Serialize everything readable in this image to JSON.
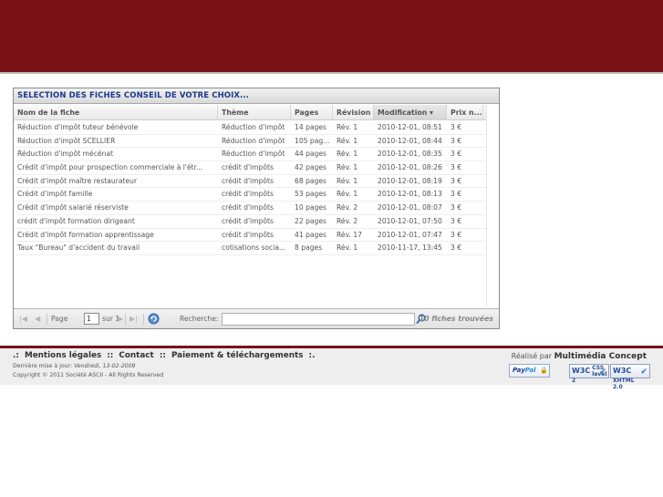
{
  "grid": {
    "title": "SELECTION DES FICHES CONSEIL DE VOTRE CHOIX...",
    "columns": [
      "Nom de la fiche",
      "Thème",
      "Pages",
      "Révision",
      "Modification ▾",
      "Prix n..."
    ],
    "rows": [
      [
        "Réduction d'impôt tuteur bénévole",
        "Réduction d'impôt",
        "14 pages",
        "Rév. 1",
        "2010-12-01, 08:51",
        "3 €"
      ],
      [
        "Réduction d'impôt SCELLIER",
        "Réduction d'impôt",
        "105 pag...",
        "Rév. 1",
        "2010-12-01, 08:44",
        "3 €"
      ],
      [
        "Réduction d'impôt mécénat",
        "Réduction d'impôt",
        "44 pages",
        "Rév. 1",
        "2010-12-01, 08:35",
        "3 €"
      ],
      [
        "Crédit d'impôt pour prospection commerciale à l'étr...",
        "crédit d'impôts",
        "42 pages",
        "Rév. 1",
        "2010-12-01, 08:26",
        "3 €"
      ],
      [
        "Crédit d'impôt maître restaurateur",
        "crédit d'impôts",
        "68 pages",
        "Rév. 1",
        "2010-12-01, 08:19",
        "3 €"
      ],
      [
        "Crédit d'impôt famille",
        "crédit d'impôts",
        "53 pages",
        "Rév. 1",
        "2010-12-01, 08:13",
        "3 €"
      ],
      [
        "Crédit d'impôt salarié réserviste",
        "crédit d'impôts",
        "10 pages",
        "Rév. 2",
        "2010-12-01, 08:07",
        "3 €"
      ],
      [
        "crédit d'impôt formation dirigeant",
        "crédit d'impôts",
        "22 pages",
        "Rév. 2",
        "2010-12-01, 07:50",
        "3 €"
      ],
      [
        "Crédit d'impôt formation apprentissage",
        "crédit d'impôts",
        "41 pages",
        "Rév. 17",
        "2010-12-01, 07:47",
        "3 €"
      ],
      [
        "Taux \"Bureau\" d'accident du travail",
        "cotisations socia...",
        "8 pages",
        "Rév. 1",
        "2010-11-17, 13:45",
        "3 €"
      ]
    ],
    "pager": {
      "page_label": "Page",
      "page_value": "1",
      "of_label": "sur 1",
      "search_label": "Recherche:",
      "search_value": "",
      "found_text": "10 fiches trouvées"
    }
  },
  "footer": {
    "links": [
      ".:",
      "Mentions légales",
      "::",
      "Contact",
      "::",
      "Paiement & téléchargements",
      ":."
    ],
    "update_label": "Dernière mise à jour:",
    "update_value": "Vendredi, 13-02-2009",
    "copyright": "Copyright © 2011 Société ASCII - All Rights Reserved",
    "realise_label": "Réalisé par",
    "realise_by": "Multimédia Concept",
    "paypal": {
      "pay": "Pay",
      "pal": "Pal"
    },
    "badges": [
      {
        "w3c": "W3C",
        "line1": "CSS",
        "line2": "level 2"
      },
      {
        "w3c": "W3C",
        "line1": "XHTML",
        "line2": "2.0"
      }
    ]
  },
  "colors": {
    "header": "#7a1218",
    "title_text": "#1c3a8a"
  }
}
